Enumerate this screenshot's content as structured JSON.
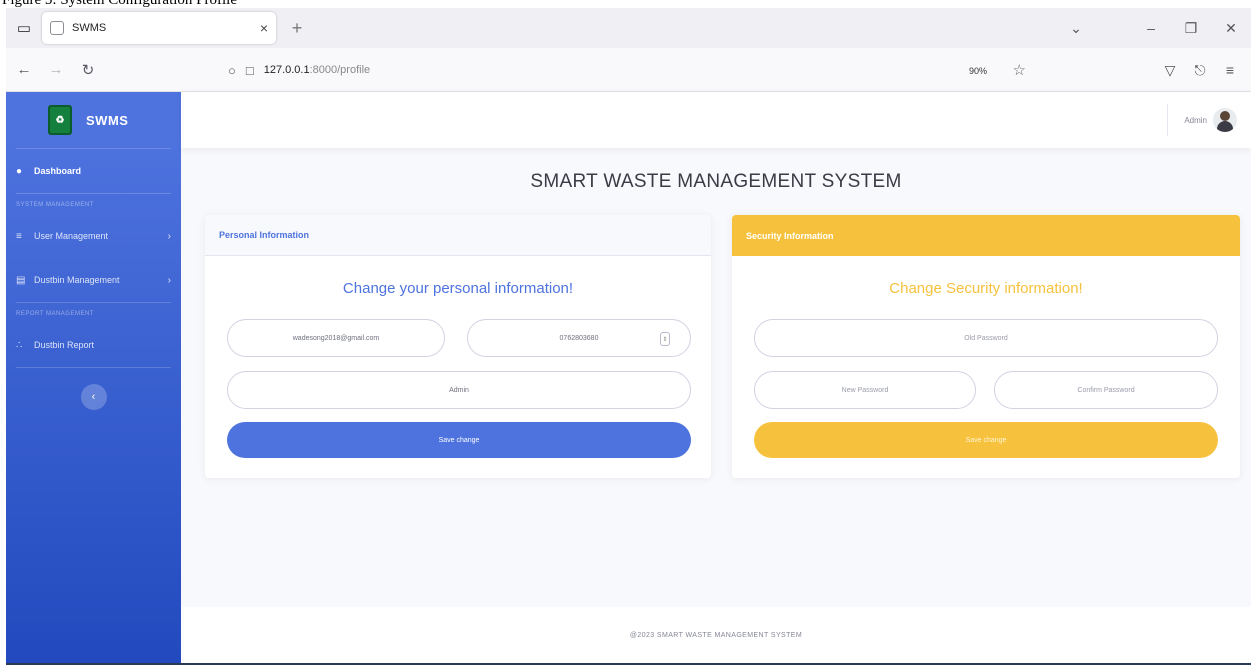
{
  "caption": "Figure 5: System Configuration Profile",
  "browser": {
    "tab_title": "SWMS",
    "url_host": "127.0.0.1",
    "url_path": ":8000/profile",
    "zoom": "90%"
  },
  "sidebar": {
    "brand": "SWMS",
    "dashboard": "Dashboard",
    "heading_system": "SYSTEM MANAGEMENT",
    "user_management": "User Management",
    "dustbin_management": "Dustbin Management",
    "heading_report": "REPORT MANAGEMENT",
    "dustbin_report": "Dustbin Report"
  },
  "topbar": {
    "user_name": "Admin"
  },
  "page": {
    "heading": "SMART WASTE MANAGEMENT SYSTEM"
  },
  "personal": {
    "header": "Personal Information",
    "title": "Change your personal information!",
    "email": "wadesong2018@gmail.com",
    "phone": "0762803680",
    "name": "Admin",
    "button": "Save change"
  },
  "security": {
    "header": "Security Information",
    "title": "Change Security information!",
    "old_password": "Old Password",
    "new_password": "New Password",
    "confirm_password": "Confirm Password",
    "button": "Save change"
  },
  "footer": {
    "text": "@2023 SMART WASTE MANAGEMENT SYSTEM"
  },
  "colors": {
    "primary": "#4e73df",
    "warning": "#f6c23e",
    "sidebar_dark": "#224abe"
  }
}
